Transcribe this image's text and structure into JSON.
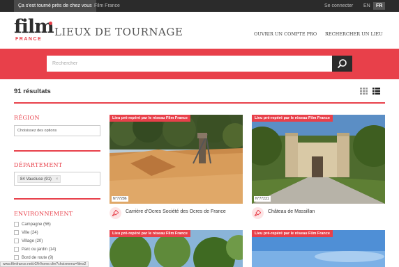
{
  "topbar": {
    "tab_active": "Ça s'est tourné près de chez vous",
    "tab_film_france": "Film France",
    "login": "Se connecter",
    "lang_en": "EN",
    "lang_fr": "FR"
  },
  "header": {
    "logo_film": "film",
    "logo_france": "FRANCE",
    "title": "LIEUX DE TOURNAGE",
    "nav_open_account": "OUVRIR UN COMPTE PRO",
    "nav_search_place": "RECHERCHER UN LIEU"
  },
  "search": {
    "placeholder": "Rechercher"
  },
  "results": {
    "count": "91 résultats"
  },
  "sidebar": {
    "region_heading": "RÉGION",
    "region_placeholder": "Choisissez des options",
    "departement_heading": "DÉPARTEMENT",
    "departement_selected": "84 Vaucluse (91)",
    "chip_remove": "×",
    "environnement_heading": "ENVIRONNEMENT",
    "environnement_items": [
      {
        "label": "Campagne (56)"
      },
      {
        "label": "Ville (24)"
      },
      {
        "label": "Village (20)"
      },
      {
        "label": "Parc ou jardin (14)"
      },
      {
        "label": "Bord de route (9)"
      }
    ]
  },
  "cards": [
    {
      "badge": "Lieu pré-repéré par le réseau Film France",
      "number": "N°77286",
      "title": "Carrière d'Ocres Société des Ocres de France"
    },
    {
      "badge": "Lieu pré-repéré par le réseau Film France",
      "number": "N°77231",
      "title": "Château de Massillan"
    },
    {
      "badge": "Lieu pré-repéré par le réseau Film France"
    },
    {
      "badge": "Lieu pré-repéré par le réseau Film France"
    }
  ],
  "statusbar": {
    "url": "www.filmfrance.net/v2/fr/home.cfm?choixmenu=films2"
  },
  "colors": {
    "accent": "#e8404a",
    "dark": "#2b2b2b"
  }
}
